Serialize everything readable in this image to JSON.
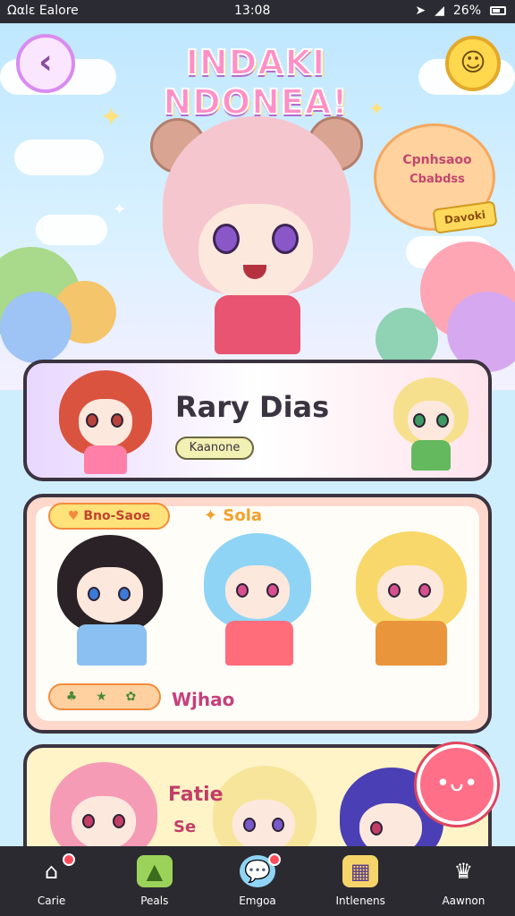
{
  "status_bar": {
    "carrier": "Ωαlɛ Ealore",
    "time": "13:08",
    "battery": "26%",
    "icons": [
      "location-arrow-icon",
      "signal-icon",
      "battery-icon"
    ]
  },
  "header": {
    "title": "INDAKI NDONEA!",
    "back_icon": "chevron-left-icon",
    "chat_icon": "smiley-chat-icon"
  },
  "hero": {
    "badge_line1": "Cpnhsaoo",
    "badge_line2": "Cbabdss",
    "badge_tag": "Davoki"
  },
  "featured": {
    "name": "Rary Dias",
    "tag": "Kaanone"
  },
  "collection": {
    "choice_label": "Bno-Saoe",
    "solo_label": "Sola",
    "icon_row": "♣ ★ ✿",
    "footer_label": "Wjhao"
  },
  "third_card": {
    "label": "Fatie",
    "sub": "Se"
  },
  "bottom_nav": {
    "items": [
      {
        "label": "Carie",
        "icon": "house-icon",
        "badge": true
      },
      {
        "label": "Peals",
        "icon": "tent-icon",
        "badge": false
      },
      {
        "label": "Emgoa",
        "icon": "chat-bubble-icon",
        "badge": true
      },
      {
        "label": "Intlenens",
        "icon": "gallery-icon",
        "badge": false
      },
      {
        "label": "Aawnon",
        "icon": "crown-icon",
        "badge": false
      }
    ]
  },
  "colors": {
    "accent_pink": "#ff8fc6",
    "accent_purple": "#b46ad1",
    "nav_bg": "#2b2a31"
  }
}
